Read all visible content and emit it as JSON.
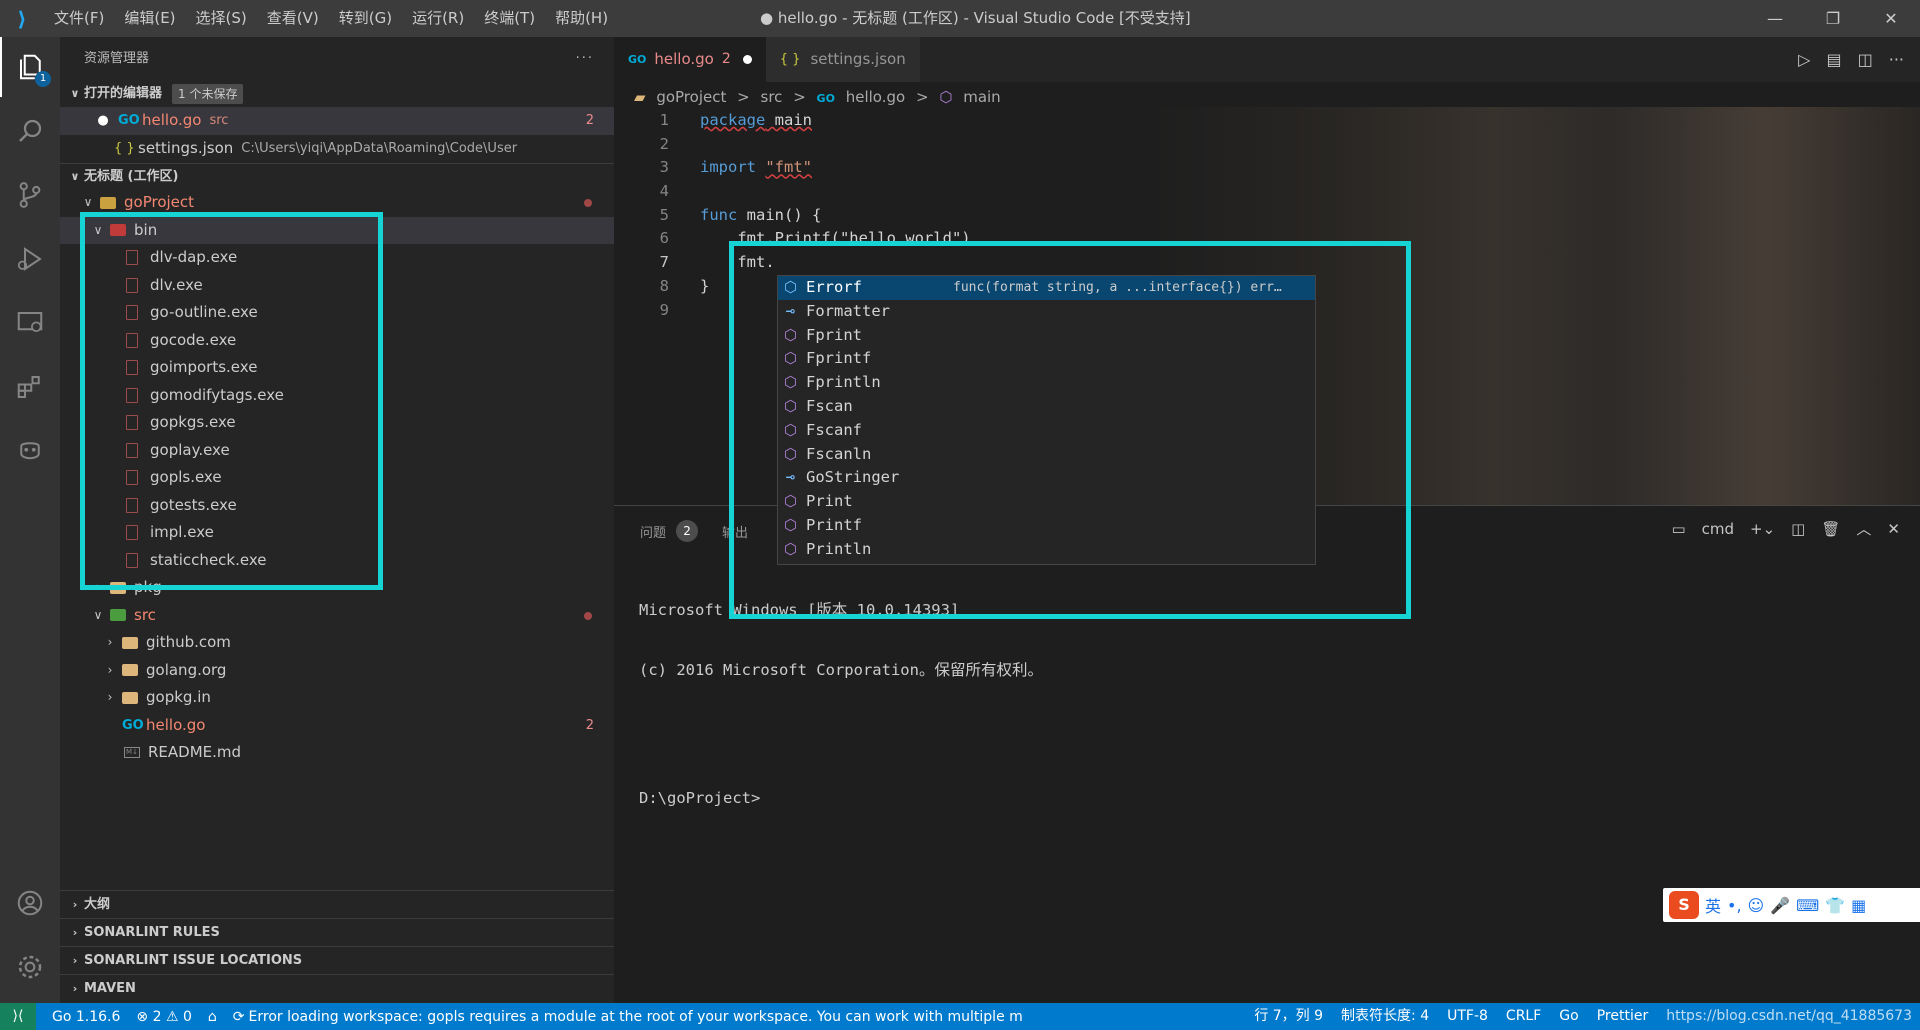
{
  "window": {
    "title": "● hello.go - 无标题 (工作区) - Visual Studio Code [不受支持]",
    "menu": [
      "文件(F)",
      "编辑(E)",
      "选择(S)",
      "查看(V)",
      "转到(G)",
      "运行(R)",
      "终端(T)",
      "帮助(H)"
    ],
    "controls": [
      "—",
      "❐",
      "✕"
    ]
  },
  "activity": {
    "explorer_badge": "1"
  },
  "sidebar": {
    "title": "资源管理器",
    "more": "···",
    "open_editors": {
      "label": "打开的编辑器",
      "unsaved": "1 个未保存",
      "items": [
        {
          "name": "hello.go",
          "hint": "src",
          "count": "2"
        },
        {
          "name": "settings.json",
          "hint": "C:\\Users\\yiqi\\AppData\\Roaming\\Code\\User"
        }
      ]
    },
    "workspace": {
      "label": "无标题 (工作区)",
      "project": "goProject",
      "bin": "bin",
      "bin_files": [
        "dlv-dap.exe",
        "dlv.exe",
        "go-outline.exe",
        "gocode.exe",
        "goimports.exe",
        "gomodifytags.exe",
        "gopkgs.exe",
        "goplay.exe",
        "gopls.exe",
        "gotests.exe",
        "impl.exe",
        "staticcheck.exe"
      ],
      "pkg": "pkg",
      "src": "src",
      "src_folders": [
        "github.com",
        "golang.org",
        "gopkg.in"
      ],
      "hello": "hello.go",
      "hello_count": "2",
      "readme": "README.md"
    },
    "bottom_sections": [
      "大纲",
      "SONARLINT RULES",
      "SONARLINT ISSUE LOCATIONS",
      "MAVEN"
    ]
  },
  "editor": {
    "tabs": [
      {
        "label": "hello.go",
        "count": "2"
      },
      {
        "label": "settings.json"
      }
    ],
    "breadcrumb": [
      "goProject",
      ">",
      "src",
      ">",
      "hello.go",
      ">",
      "main"
    ],
    "line_numbers": [
      "1",
      "2",
      "3",
      "4",
      "5",
      "6",
      "7",
      "8",
      "9"
    ],
    "code": {
      "l1_kw": "package",
      "l1_rest": " main",
      "l3_kw": "import",
      "l3_str": "\"fmt\"",
      "l5_kw": "func",
      "l5_rest": " main() {",
      "l6": "    fmt.Printf(\"hello world\")",
      "l7": "    fmt.",
      "l8": "}"
    },
    "suggestions": [
      {
        "label": "Errorf",
        "kind": "method",
        "detail": "func(format string, a ...interface{}) err…"
      },
      {
        "label": "Formatter",
        "kind": "interface"
      },
      {
        "label": "Fprint",
        "kind": "method"
      },
      {
        "label": "Fprintf",
        "kind": "method"
      },
      {
        "label": "Fprintln",
        "kind": "method"
      },
      {
        "label": "Fscan",
        "kind": "method"
      },
      {
        "label": "Fscanf",
        "kind": "method"
      },
      {
        "label": "Fscanln",
        "kind": "method"
      },
      {
        "label": "GoStringer",
        "kind": "interface"
      },
      {
        "label": "Print",
        "kind": "method"
      },
      {
        "label": "Printf",
        "kind": "method"
      },
      {
        "label": "Println",
        "kind": "method"
      }
    ]
  },
  "panel": {
    "problems_label": "问题",
    "problems_count": "2",
    "output_label": "输出",
    "terminal_name": "cmd",
    "terminal_lines": [
      "Microsoft Windows [版本 10.0.14393]",
      "(c) 2016 Microsoft Corporation。保留所有权利。",
      "",
      "D:\\goProject>"
    ]
  },
  "ime": {
    "logo": "S",
    "mode": "英"
  },
  "status": {
    "go_version": "Go 1.16.6",
    "errors": "2",
    "warnings": "0",
    "message": "Error loading workspace: gopls requires a module at the root of your workspace. You can work with multiple m",
    "position": "行 7，列 9",
    "tab_size": "制表符长度: 4",
    "encoding": "UTF-8",
    "eol": "CRLF",
    "language": "Go",
    "formatter": "Prettier",
    "watermark": "https://blog.csdn.net/qq_41885673"
  },
  "colors": {
    "highlight_box": "#16d4d4",
    "status_bar": "#007acc",
    "error_text": "#f48771"
  }
}
